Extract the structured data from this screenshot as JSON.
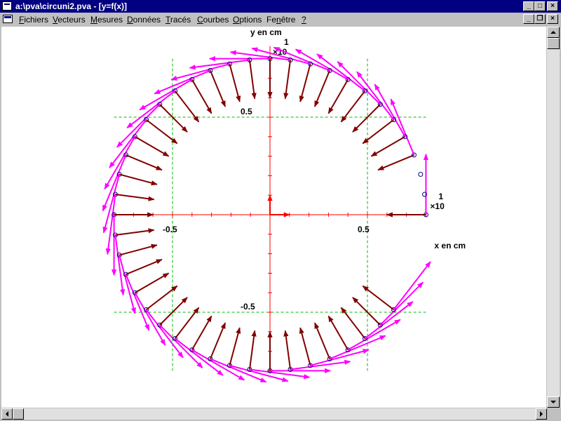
{
  "window": {
    "title": "a:\\pva\\circuni2.pva - [y=f(x)]"
  },
  "menu": [
    "Fichiers",
    "Vecteurs",
    "Mesures",
    "Données",
    "Tracés",
    "Courbes",
    "Options",
    "Fenêtre",
    "?"
  ],
  "menu_accel": [
    "F",
    "V",
    "M",
    "D",
    "T",
    "C",
    "O",
    "n",
    "?"
  ],
  "chart_data": {
    "type": "scatter",
    "title": "",
    "xlabel": "x en cm",
    "ylabel": "y en cm",
    "x_scale_label": "×10",
    "y_scale_label": "×10",
    "x_scale_exp": "1",
    "y_scale_exp": "1",
    "xlim": [
      -0.8,
      0.8
    ],
    "ylim": [
      -0.8,
      0.8
    ],
    "xticks": [
      -0.5,
      0.5
    ],
    "yticks": [
      -0.5,
      0.5
    ],
    "xtick_labels": [
      "-0.5",
      "0.5"
    ],
    "ytick_labels": [
      "-0.5",
      "0.5"
    ],
    "grid": true,
    "trajectory": {
      "radius": 0.8,
      "points": 44,
      "start_angle_deg": 0,
      "step_deg": 7.5,
      "direction": "counterclockwise",
      "missing_indices": [
        1,
        2
      ]
    },
    "series": [
      {
        "values": [
          0.31
        ],
        "color": "#ff00ff"
      },
      {
        "values": [
          0.2
        ],
        "color": "#800000"
      },
      {
        "values": [
          0.1
        ],
        "color": "#ff0000"
      }
    ],
    "colors": {
      "axes": "#ff0000",
      "grid": "#00bb00",
      "points": "#000080"
    }
  }
}
